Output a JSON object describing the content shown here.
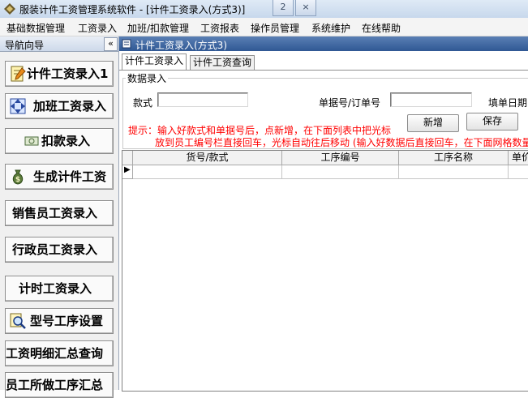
{
  "window": {
    "title": "服装计件工资管理系统软件  - [计件工资录入(方式3)]",
    "restore_label": "2",
    "close_label": "×"
  },
  "menu": [
    {
      "label": "基础数据管理"
    },
    {
      "label": "工资录入"
    },
    {
      "label": "加班/扣款管理"
    },
    {
      "label": "工资报表"
    },
    {
      "label": "操作员管理"
    },
    {
      "label": "系统维护"
    },
    {
      "label": "在线帮助"
    }
  ],
  "nav": {
    "header": "导航向导",
    "collapse_label": "«",
    "items": [
      {
        "label": "计件工资录入1",
        "icon": "pencil-doc-icon"
      },
      {
        "label": "加班工资录入",
        "icon": "arrows-icon"
      },
      {
        "label": "扣款录入",
        "icon": "cash-icon"
      },
      {
        "label": "生成计件工资",
        "icon": "money-bag-icon"
      },
      {
        "label": "销售员工资录入",
        "icon": ""
      },
      {
        "label": "行政员工资录入",
        "icon": ""
      },
      {
        "label": "计时工资录入",
        "icon": ""
      },
      {
        "label": "型号工序设置",
        "icon": "magnifier-icon"
      },
      {
        "label": "工资明细汇总查询",
        "icon": ""
      },
      {
        "label": "员工所做工序汇总",
        "icon": ""
      }
    ]
  },
  "child": {
    "title": "计件工资录入(方式3)",
    "tabs": [
      {
        "label": "计件工资录入",
        "active": true
      },
      {
        "label": "计件工资查询",
        "active": false
      }
    ],
    "group_title": "数据录入",
    "fields": {
      "style_label": "款式",
      "style_value": "",
      "order_label": "单据号/订单号",
      "order_value": "",
      "date_label": "填单日期"
    },
    "buttons": {
      "new": "新增",
      "save": "保存"
    },
    "hint_line1": "提示：输入好款式和单据号后，点新增，在下面列表中把光标",
    "hint_line2": "放到员工编号栏直接回车，光标自动往后移动 (输入好数据后直接回车，在下面网格数量",
    "grid": {
      "columns": [
        "货号/款式",
        "工序编号",
        "工序名称",
        "单价"
      ],
      "row_indicator": "▶"
    }
  }
}
